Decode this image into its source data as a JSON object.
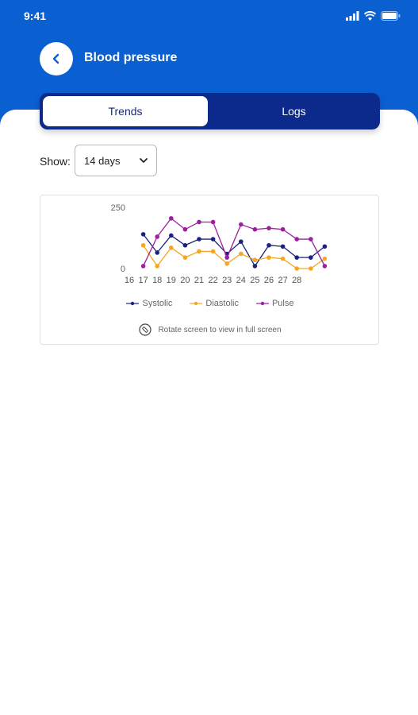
{
  "status_bar": {
    "time": "9:41"
  },
  "header": {
    "title": "Blood pressure",
    "back_icon": "chevron-left-icon"
  },
  "tabs": [
    {
      "label": "Trends",
      "active": true
    },
    {
      "label": "Logs",
      "active": false
    }
  ],
  "filter": {
    "label": "Show:",
    "selected": "14 days"
  },
  "chart_data": {
    "type": "line",
    "x": [
      16,
      17,
      18,
      19,
      20,
      21,
      22,
      23,
      24,
      25,
      26,
      27,
      28
    ],
    "ylim": [
      0,
      250
    ],
    "y_ticks": [
      0,
      250
    ],
    "series": [
      {
        "name": "Systolic",
        "color": "#1a237e",
        "values": [
          null,
          140,
          65,
          135,
          95,
          120,
          120,
          60,
          110,
          10,
          95,
          90,
          45,
          45,
          90
        ]
      },
      {
        "name": "Diastolic",
        "color": "#f5a623",
        "values": [
          null,
          95,
          10,
          85,
          45,
          70,
          70,
          20,
          60,
          35,
          45,
          40,
          0,
          0,
          40
        ]
      },
      {
        "name": "Pulse",
        "color": "#9c1fa0",
        "values": [
          null,
          10,
          130,
          205,
          160,
          190,
          190,
          45,
          180,
          160,
          165,
          160,
          120,
          120,
          10
        ]
      }
    ]
  },
  "legend": {
    "systolic": "Systolic",
    "diastolic": "Diastolic",
    "pulse": "Pulse"
  },
  "hint": {
    "text": "Rotate screen to view in full screen",
    "icon": "rotate-screen-icon"
  }
}
